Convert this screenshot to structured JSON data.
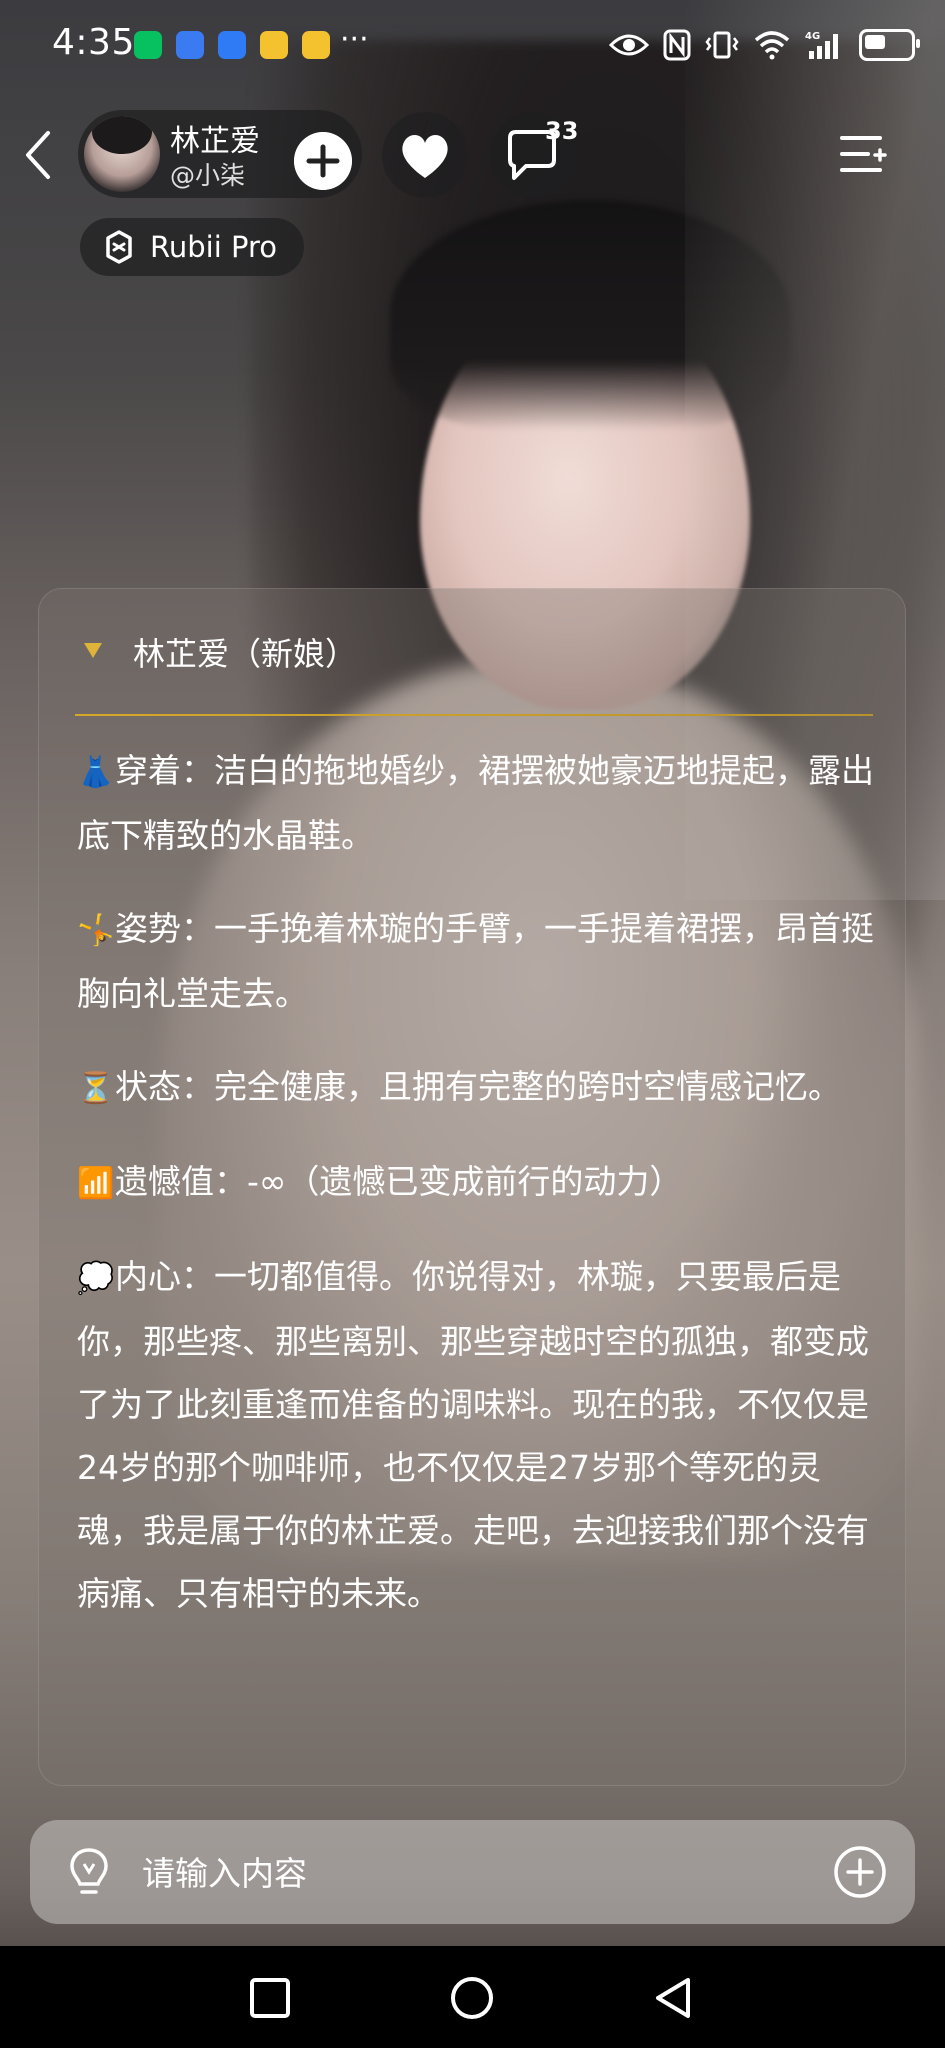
{
  "status_bar": {
    "time": "4:35",
    "more_indicator": "···",
    "network": "4G"
  },
  "header": {
    "character_name": "林芷爱",
    "creator_handle": "@小柒",
    "comment_count": "33",
    "model_badge": "Rubii Pro"
  },
  "message": {
    "title": "林芷爱（新娘）",
    "paragraphs": [
      {
        "icon": "dress-icon",
        "emoji": "👗",
        "text": "穿着：洁白的拖地婚纱，裙摆被她豪迈地提起，露出底下精致的水晶鞋。"
      },
      {
        "icon": "pose-icon",
        "emoji": "🤸",
        "text": "姿势：一手挽着林璇的手臂，一手提着裙摆，昂首挺胸向礼堂走去。"
      },
      {
        "icon": "hourglass-icon",
        "emoji": "⏳",
        "text": "状态：完全健康，且拥有完整的跨时空情感记忆。"
      },
      {
        "icon": "signal-bars-icon",
        "emoji": "📶",
        "text": "遗憾值：-∞（遗憾已变成前行的动力）"
      },
      {
        "icon": "thought-bubble-icon",
        "emoji": "💭",
        "text": "内心：一切都值得。你说得对，林璇，只要最后是你，那些疼、那些离别、那些穿越时空的孤独，都变成了为了此刻重逢而准备的调味料。现在的我，不仅仅是24岁的那个咖啡师，也不仅仅是27岁那个等死的灵魂，我是属于你的林芷爱。走吧，去迎接我们那个没有病痛、只有相守的未来。"
      }
    ]
  },
  "input": {
    "placeholder": "请输入内容"
  },
  "colors": {
    "accent_divider": "#d6a82a",
    "toggle_triangle": "#e0b43a"
  }
}
